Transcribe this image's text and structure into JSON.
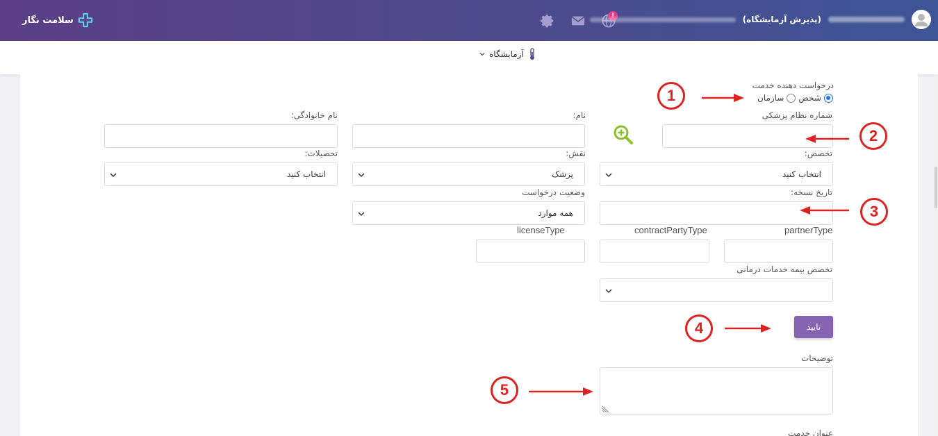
{
  "header": {
    "brand": "سلامت نگار",
    "user_role": "(پذیرش آزمایشگاه)",
    "notification_badge": "!",
    "icons": [
      "settings-gear-icon",
      "mail-icon",
      "globe-icon",
      "user-avatar-icon"
    ]
  },
  "subnav": {
    "label": "آزمایشگاه",
    "icon": "thermometer-icon"
  },
  "form": {
    "service_provider_label": "درخواست دهنده خدمت",
    "radio_person": "شخص",
    "radio_org": "سازمان",
    "radio_selected": "person",
    "medical_code_label": "شماره نظام پزشکی",
    "first_name_label": "نام:",
    "last_name_label": "نام خانوادگی:",
    "specialty_label": "تخصص:",
    "specialty_value": "انتخاب کنید",
    "role_label": "نقش:",
    "role_value": "پزشک",
    "education_label": "تحصیلات:",
    "education_value": "انتخاب کنید",
    "prescription_date_label": "تاریخ نسخه:",
    "request_status_label": "وضعیت درخواست",
    "request_status_value": "همه موارد",
    "partner_type_label": "partnerType",
    "contract_party_type_label": "contractPartyType",
    "license_type_label": "licenseType",
    "insurance_specialty_label": "تخصص بیمه خدمات درمانی",
    "confirm_label": "تایید",
    "description_label": "توضیحات",
    "service_title_label": "عنوان خدمت"
  },
  "annotations": [
    "1",
    "2",
    "3",
    "4",
    "5"
  ],
  "colors": {
    "header_start": "#5b3f86",
    "header_end": "#3d5597",
    "accent_purple": "#8664b4",
    "radio_blue": "#1e73e8",
    "annotation_red": "#d22222",
    "search_green": "#8bbf2a"
  }
}
